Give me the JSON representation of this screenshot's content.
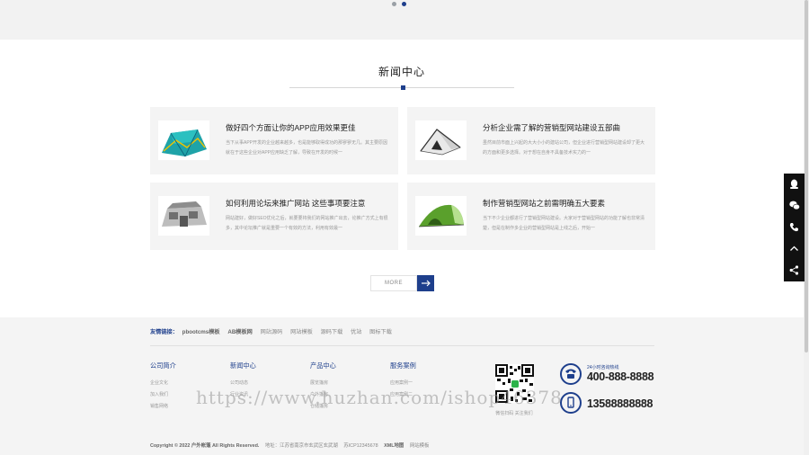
{
  "banner": {
    "dots_total": 2,
    "active_dot": 2
  },
  "news": {
    "section_title": "新闻中心",
    "items": [
      {
        "title": "做好四个方面让你的APP应用效果更佳",
        "desc": "当下从事APP开发的企业越来越多，也是能够取得成功的那寥寥无几。其主要原因就在于这些企业对APP应用缺乏了解，导致在开发的时候一"
      },
      {
        "title": "分析企业需了解的营销型网站建设五部曲",
        "desc": "虽然目前市面上兴起的大大小小的建站公司，但企业进行营销型网站建设却了更大的方面和更多选择。对于想在自身不具备技术实力的一"
      },
      {
        "title": "如何利用论坛来推广网站 这些事项要注意",
        "desc": "网站建好，做好SEO优化之后，就要要将我们的网站推广出去，论推广方式上有很多，其中论坛推广就是重要一个有效的方法，利用有效最一"
      },
      {
        "title": "制作营销型网站之前需明确五大要素",
        "desc": "当下不少企业都进行了营销型网站建设。大家对于营销型网站的功能了解也非常清楚，但是在制作多企业的营销型网站是上线之后，开始一"
      }
    ],
    "more_label": "MORE"
  },
  "footer": {
    "links_label": "友情链接：",
    "links": [
      "pbootcms模板",
      "AB模板网",
      "网站源码",
      "网站模板",
      "源码下载",
      "优站",
      "图标下载"
    ],
    "columns": [
      {
        "heading": "公司简介",
        "items": [
          "企业文化",
          "加入我们",
          "销售网络"
        ]
      },
      {
        "heading": "新闻中心",
        "items": [
          "公司动态",
          "行业资讯"
        ]
      },
      {
        "heading": "产品中心",
        "items": [
          "展览篷房",
          "户外篷房",
          "仓储篷房"
        ]
      },
      {
        "heading": "服务案例",
        "items": [
          "应用案例一",
          "应用案例二"
        ]
      }
    ],
    "qr_caption": "微信扫码 关注我们",
    "hotline_label": "24小时咨询热线",
    "hotline": "400-888-8888",
    "mobile": "13588888888",
    "copyright": "Copyright © 2022 户外帐篷 All Rights Reserved.",
    "address": "地址：江苏省南京市玄武区玄武湖",
    "icp": "苏ICP12345678",
    "sitemap": "XML地图",
    "template_link": "网站模板"
  },
  "watermark": "https://www.huzhan.com/ishop46378",
  "colors": {
    "brand": "#1e3f8c",
    "footer_bg": "#f4f4f4",
    "card_bg": "#f4f4f4"
  },
  "side_toolbar": [
    "qq-icon",
    "wechat-icon",
    "phone-icon",
    "back-to-top-icon",
    "share-icon"
  ]
}
